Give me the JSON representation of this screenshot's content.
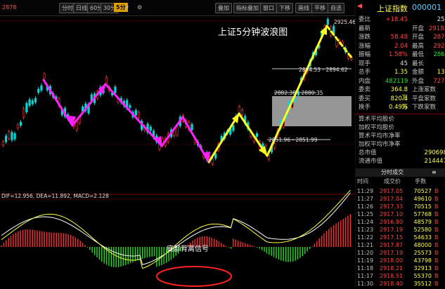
{
  "toolbar": {
    "items": [
      {
        "label": "分时",
        "active": false
      },
      {
        "label": "日线",
        "active": false
      },
      {
        "label": "60分",
        "active": false
      },
      {
        "label": "30分",
        "active": false
      },
      {
        "label": "5分",
        "active": true
      }
    ],
    "right_items": [
      {
        "label": "叠加"
      },
      {
        "label": "指标叠加"
      },
      {
        "label": "窗口"
      },
      {
        "label": "下移"
      },
      {
        "label": "画线"
      },
      {
        "label": "平移"
      },
      {
        "label": "自选"
      }
    ]
  },
  "chart": {
    "title": "上证5分钟波浪图",
    "corner_value_left": "2878",
    "corner_value_right": "2925.46",
    "annotations": {
      "resist": "2894.53 - 2894.62",
      "mid_low": "2882.38 - 2880.35",
      "support": "2851.96 - 2851.99"
    },
    "bottom_label": "底部背离信号",
    "macd_line": "DIF=12.956, DEA=11.892, MACD=2.128"
  },
  "quote": {
    "title": "上证指数",
    "code": "000001",
    "rows": [
      {
        "k": "委比",
        "v": "+18.45",
        "vc": "red",
        "k2": "",
        "v2": "255",
        "v2c": "white"
      },
      {
        "k": "最新",
        "v": "",
        "vc": "red",
        "k2": "开盘",
        "v2": "2918.90",
        "v2c": "red"
      },
      {
        "k": "涨跌",
        "v": "58.48",
        "vc": "red",
        "k2": "开盘",
        "v2": "2871",
        "v2c": "red"
      },
      {
        "k": "涨幅",
        "v": "2.04",
        "vc": "red",
        "k2": "最高",
        "v2": "2928",
        "v2c": "red"
      },
      {
        "k": "振幅",
        "v": "1.58%",
        "vc": "red",
        "k2": "最低",
        "v2": "2868",
        "v2c": "green"
      },
      {
        "k": "现手",
        "v": "45",
        "vc": "white",
        "k2": "最长",
        "v2": "",
        "v2c": "white"
      },
      {
        "k": "总手",
        "v": "1.35",
        "vc": "yellow",
        "k2": "金额",
        "v2": "135",
        "v2c": "yellow"
      },
      {
        "k": "内盘",
        "v": "482119",
        "vc": "green",
        "k2": "外盘",
        "v2": "7275",
        "v2c": "red"
      },
      {
        "k": "委卖",
        "v": "364.8万",
        "vc": "yellow",
        "k2": "上涨家数",
        "v2": "",
        "v2c": "red"
      },
      {
        "k": "委买",
        "v": "820.4万",
        "vc": "yellow",
        "k2": "平盘家数",
        "v2": "",
        "v2c": "white"
      },
      {
        "k": "换手",
        "v": "0.49%",
        "vc": "yellow",
        "k2": "下跌家数",
        "v2": "",
        "v2c": "green"
      }
    ],
    "extra": [
      {
        "k": "算术平均股价",
        "v": ""
      },
      {
        "k": "加权平均股价",
        "v": ""
      },
      {
        "k": "算术平均市净率",
        "v": ""
      },
      {
        "k": "加权平均市净率",
        "v": ""
      },
      {
        "k": "总市值",
        "v": "290698"
      },
      {
        "k": "流通市值",
        "v": "214447"
      }
    ],
    "trades_header": "分时成交",
    "trades_cols": [
      "时间",
      "成交价",
      "手数"
    ],
    "trades": [
      {
        "t": "11:29",
        "p": "2917.05",
        "v": "70527"
      },
      {
        "t": "11:27",
        "p": "2917.04",
        "v": "49610"
      },
      {
        "t": "11:26",
        "p": "2917.33",
        "v": "70515"
      },
      {
        "t": "11:25",
        "p": "2917.10",
        "v": "57768"
      },
      {
        "t": "11:24",
        "p": "2916.80",
        "v": "48579"
      },
      {
        "t": "11:23",
        "p": "2917.19",
        "v": "52580"
      },
      {
        "t": "11:22",
        "p": "2917.15",
        "v": "54633"
      },
      {
        "t": "11:21",
        "p": "2917.87",
        "v": "48000"
      },
      {
        "t": "11:20",
        "p": "2917.19",
        "v": "25573"
      },
      {
        "t": "11:19",
        "p": "2918.00",
        "v": "43798"
      },
      {
        "t": "11:18",
        "p": "2918.21",
        "v": "32913"
      },
      {
        "t": "11:17",
        "p": "2918.51",
        "v": "55370"
      },
      {
        "t": "11:30",
        "p": "2918.40",
        "v": "35512"
      }
    ]
  },
  "colors": {
    "up": "#ff3030",
    "down": "#00e0e0",
    "wave_up": "#ffff20",
    "wave_down": "#ff20ff",
    "dif": "#ffffff",
    "dea": "#ffff40"
  }
}
